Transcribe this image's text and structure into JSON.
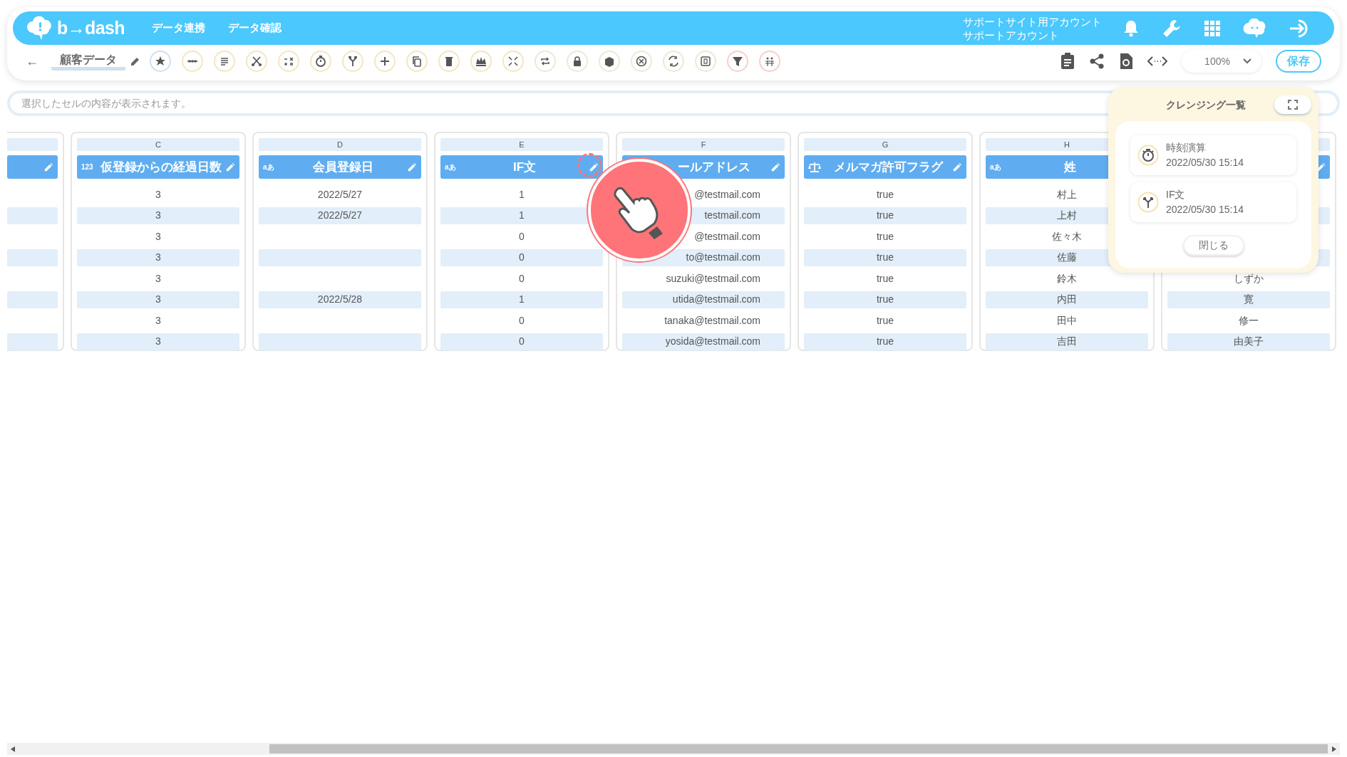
{
  "header": {
    "logo": "b→dash",
    "nav": [
      {
        "label": "データ連携"
      },
      {
        "label": "データ確認"
      }
    ],
    "account": [
      "サポートサイト用アカウント",
      "サポートアカウント"
    ]
  },
  "toolbar": {
    "back": "←",
    "title": "顧客データ",
    "zoom": "100%",
    "save": "保存"
  },
  "formula_bar": {
    "placeholder": "選択したセルの内容が表示されます。"
  },
  "columns": [
    {
      "kind": "partial",
      "cells": [
        null,
        null,
        null,
        null,
        null,
        null,
        null,
        null
      ]
    },
    {
      "kind": "full",
      "letter": "C",
      "title": "仮登録からの経過日数",
      "type_label": "123",
      "cells": [
        "3",
        "3",
        "3",
        "3",
        "3",
        "3",
        "3",
        "3"
      ]
    },
    {
      "kind": "full",
      "letter": "D",
      "title": "会員登録日",
      "type_label": "aあ",
      "cells": [
        "2022/5/27",
        "2022/5/27",
        null,
        null,
        null,
        "2022/5/28",
        null,
        null
      ]
    },
    {
      "kind": "full",
      "letter": "E",
      "title": "IF文",
      "type_label": "aあ",
      "cells": [
        "1",
        "1",
        "0",
        "0",
        "0",
        "1",
        "0",
        "0"
      ]
    },
    {
      "kind": "covered",
      "letter": "F",
      "title": "ールアドレス",
      "cells": [
        "@testmail.com",
        "testmail.com",
        "@testmail.com",
        "to@testmail.com",
        "suzuki@testmail.com",
        "utida@testmail.com",
        "tanaka@testmail.com",
        "yosida@testmail.com"
      ]
    },
    {
      "kind": "flag",
      "letter": "G",
      "title": "メルマガ許可フラグ",
      "cells": [
        "true",
        "true",
        "true",
        "true",
        "true",
        "true",
        "true",
        "true"
      ]
    },
    {
      "kind": "underlay",
      "letter": "H",
      "title": "姓",
      "type_label": "aあ",
      "cells": [
        "村上",
        "上村",
        "佐々木",
        "佐藤",
        "鈴木",
        "内田",
        "田中",
        "吉田"
      ]
    },
    {
      "kind": "hidden",
      "cells": [
        null,
        null,
        null,
        null,
        "しずか",
        "寛",
        "修一",
        "由美子"
      ]
    }
  ],
  "cleansing_panel": {
    "title": "クレンジング一覧",
    "items": [
      {
        "kind": "timer",
        "name": "時刻演算",
        "time": "2022/05/30 15:14"
      },
      {
        "kind": "branch",
        "name": "IF文",
        "time": "2022/05/30 15:14"
      }
    ],
    "close": "閉じる"
  }
}
